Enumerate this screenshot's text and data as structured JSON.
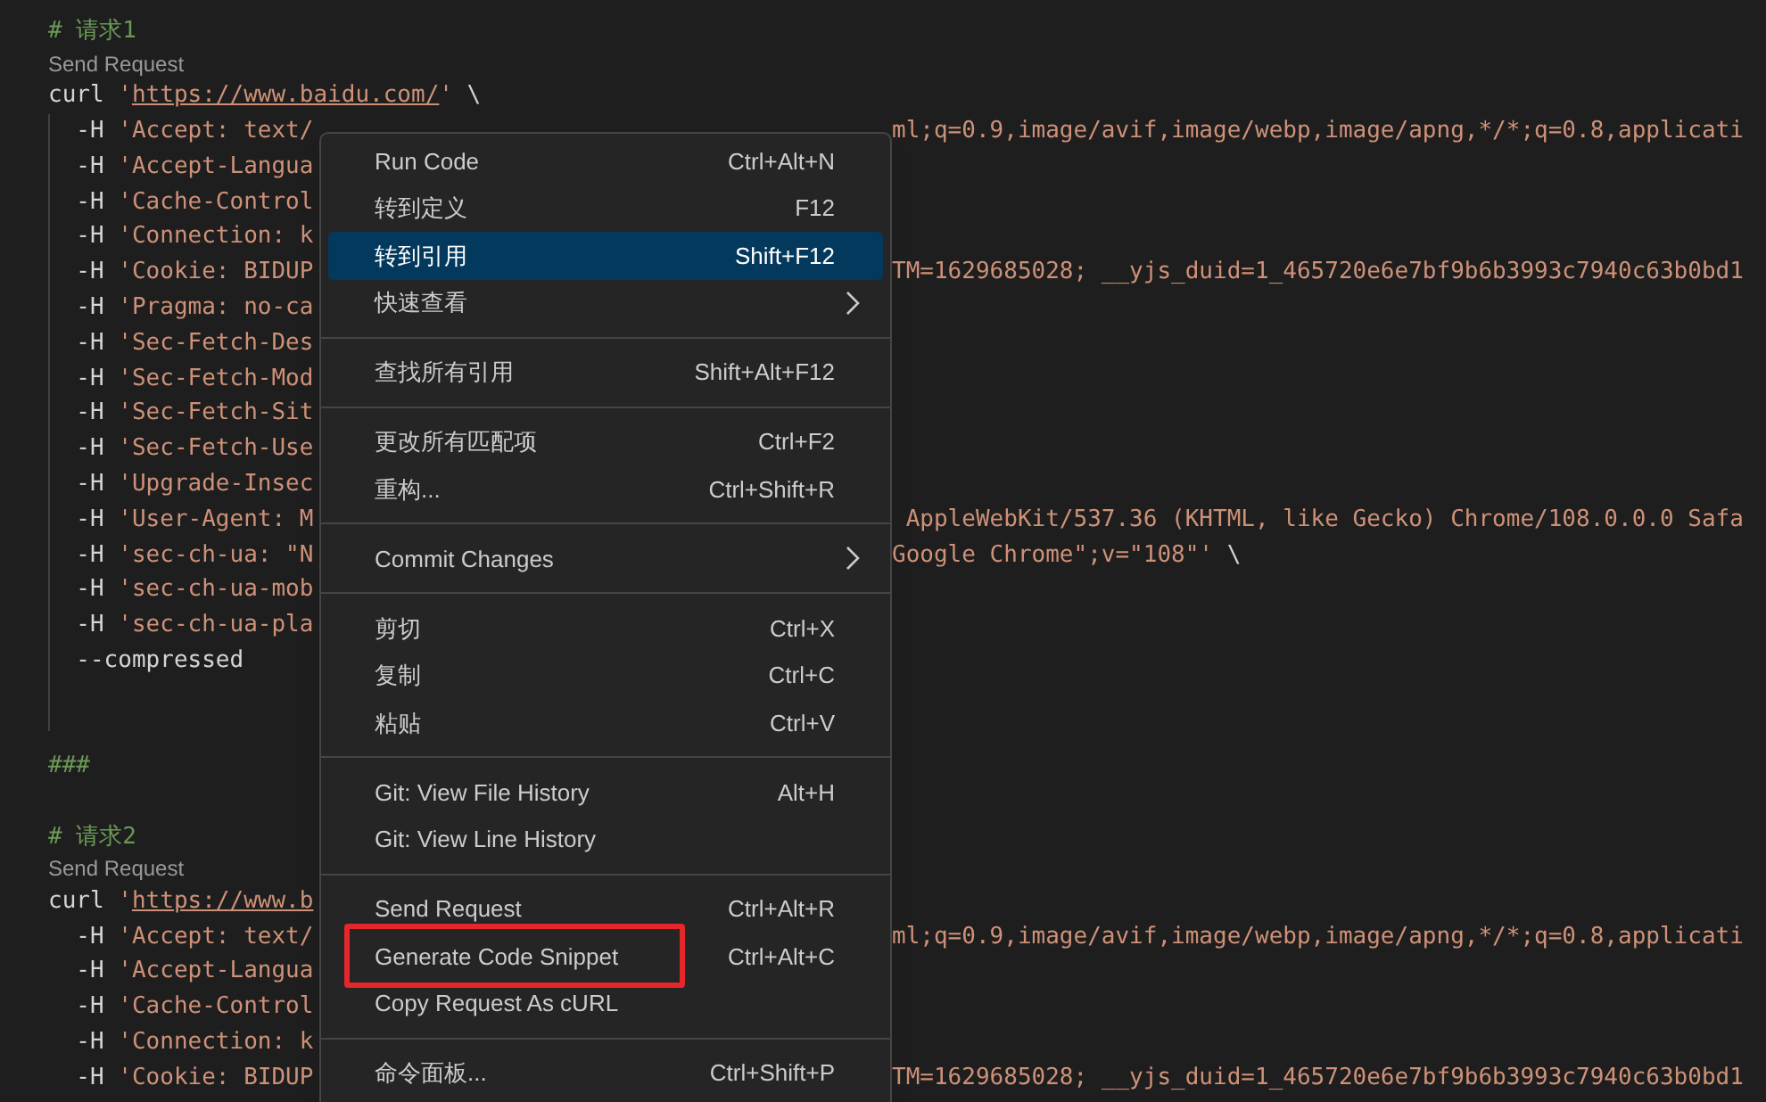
{
  "editor": {
    "lines": [
      {
        "kind": "code",
        "left": [
          {
            "text": "# 请求1",
            "kind": "comment"
          }
        ]
      },
      {
        "kind": "codelens",
        "left": [
          {
            "text": "Send Request",
            "kind": "lens"
          }
        ]
      },
      {
        "kind": "code",
        "left": [
          {
            "text": "curl ",
            "kind": "plain"
          },
          {
            "text": "'",
            "kind": "string"
          },
          {
            "text": "https://www.baidu.com/",
            "kind": "link"
          },
          {
            "text": "'",
            "kind": "string"
          },
          {
            "text": " \\",
            "kind": "plain"
          }
        ]
      },
      {
        "kind": "code",
        "left": [
          {
            "text": "  -H",
            "kind": "plain"
          },
          {
            "text": " 'Accept: text/",
            "kind": "string"
          }
        ],
        "right": [
          {
            "text": "ml;q=0.9,image/avif,image/webp,image/apng,*/*;q=0.8,applicati",
            "kind": "string"
          }
        ]
      },
      {
        "kind": "code",
        "left": [
          {
            "text": "  -H",
            "kind": "plain"
          },
          {
            "text": " 'Accept-Langua",
            "kind": "string"
          }
        ]
      },
      {
        "kind": "code",
        "left": [
          {
            "text": "  -H",
            "kind": "plain"
          },
          {
            "text": " 'Cache-Control",
            "kind": "string"
          }
        ]
      },
      {
        "kind": "code",
        "left": [
          {
            "text": "  -H",
            "kind": "plain"
          },
          {
            "text": " 'Connection: k",
            "kind": "string"
          }
        ]
      },
      {
        "kind": "code",
        "left": [
          {
            "text": "  -H",
            "kind": "plain"
          },
          {
            "text": " 'Cookie: BIDUP",
            "kind": "string"
          }
        ],
        "right": [
          {
            "text": "TM=1629685028; __yjs_duid=1_465720e6e7bf9b6b3993c7940c63b0bd1",
            "kind": "string"
          }
        ]
      },
      {
        "kind": "code",
        "left": [
          {
            "text": "  -H",
            "kind": "plain"
          },
          {
            "text": " 'Pragma: no-ca",
            "kind": "string"
          }
        ]
      },
      {
        "kind": "code",
        "left": [
          {
            "text": "  -H",
            "kind": "plain"
          },
          {
            "text": " 'Sec-Fetch-Des",
            "kind": "string"
          }
        ]
      },
      {
        "kind": "code",
        "left": [
          {
            "text": "  -H",
            "kind": "plain"
          },
          {
            "text": " 'Sec-Fetch-Mod",
            "kind": "string"
          }
        ]
      },
      {
        "kind": "code",
        "left": [
          {
            "text": "  -H",
            "kind": "plain"
          },
          {
            "text": " 'Sec-Fetch-Sit",
            "kind": "string"
          }
        ]
      },
      {
        "kind": "code",
        "left": [
          {
            "text": "  -H",
            "kind": "plain"
          },
          {
            "text": " 'Sec-Fetch-Use",
            "kind": "string"
          }
        ]
      },
      {
        "kind": "code",
        "left": [
          {
            "text": "  -H",
            "kind": "plain"
          },
          {
            "text": " 'Upgrade-Insec",
            "kind": "string"
          }
        ]
      },
      {
        "kind": "code",
        "left": [
          {
            "text": "  -H",
            "kind": "plain"
          },
          {
            "text": " 'User-Agent: M",
            "kind": "string"
          }
        ],
        "right": [
          {
            "text": " AppleWebKit/537.36 (KHTML, like Gecko) Chrome/108.0.0.0 Safa",
            "kind": "string"
          }
        ]
      },
      {
        "kind": "code",
        "left": [
          {
            "text": "  -H",
            "kind": "plain"
          },
          {
            "text": " 'sec-ch-ua: \"N",
            "kind": "string"
          }
        ],
        "right": [
          {
            "text": "Google Chrome\";v=\"108\"'",
            "kind": "string"
          },
          {
            "text": " \\",
            "kind": "plain"
          }
        ]
      },
      {
        "kind": "code",
        "left": [
          {
            "text": "  -H",
            "kind": "plain"
          },
          {
            "text": " 'sec-ch-ua-mob",
            "kind": "string"
          }
        ]
      },
      {
        "kind": "code",
        "left": [
          {
            "text": "  -H",
            "kind": "plain"
          },
          {
            "text": " 'sec-ch-ua-pla",
            "kind": "string"
          }
        ]
      },
      {
        "kind": "code",
        "left": [
          {
            "text": "  --compressed",
            "kind": "plain"
          }
        ]
      },
      {
        "kind": "blank"
      },
      {
        "kind": "blank"
      },
      {
        "kind": "code",
        "left": [
          {
            "text": "###",
            "kind": "comment"
          }
        ]
      },
      {
        "kind": "blank"
      },
      {
        "kind": "code",
        "left": [
          {
            "text": "# 请求2",
            "kind": "comment"
          }
        ]
      },
      {
        "kind": "codelens",
        "left": [
          {
            "text": "Send Request",
            "kind": "lens"
          }
        ]
      },
      {
        "kind": "code",
        "left": [
          {
            "text": "curl ",
            "kind": "plain"
          },
          {
            "text": "'",
            "kind": "string"
          },
          {
            "text": "https://www.b",
            "kind": "link"
          }
        ]
      },
      {
        "kind": "code",
        "left": [
          {
            "text": "  -H",
            "kind": "plain"
          },
          {
            "text": " 'Accept: text/",
            "kind": "string"
          }
        ],
        "right": [
          {
            "text": "ml;q=0.9,image/avif,image/webp,image/apng,*/*;q=0.8,applicati",
            "kind": "string"
          }
        ]
      },
      {
        "kind": "code",
        "left": [
          {
            "text": "  -H",
            "kind": "plain"
          },
          {
            "text": " 'Accept-Langua",
            "kind": "string"
          }
        ]
      },
      {
        "kind": "code",
        "left": [
          {
            "text": "  -H",
            "kind": "plain"
          },
          {
            "text": " 'Cache-Control",
            "kind": "string"
          }
        ]
      },
      {
        "kind": "code",
        "left": [
          {
            "text": "  -H",
            "kind": "plain"
          },
          {
            "text": " 'Connection: k",
            "kind": "string"
          }
        ]
      },
      {
        "kind": "code",
        "left": [
          {
            "text": "  -H",
            "kind": "plain"
          },
          {
            "text": " 'Cookie: BIDUP",
            "kind": "string"
          }
        ],
        "right": [
          {
            "text": "TM=1629685028; __yjs_duid=1_465720e6e7bf9b6b3993c7940c63b0bd1",
            "kind": "string"
          }
        ]
      }
    ]
  },
  "context_menu": {
    "items": [
      {
        "kind": "item",
        "label": "Run Code",
        "shortcut": "Ctrl+Alt+N",
        "selected": false
      },
      {
        "kind": "item",
        "label": "转到定义",
        "shortcut": "F12",
        "selected": false
      },
      {
        "kind": "item",
        "label": "转到引用",
        "shortcut": "Shift+F12",
        "selected": true
      },
      {
        "kind": "item",
        "label": "快速查看",
        "submenu": true,
        "selected": false
      },
      {
        "kind": "separator"
      },
      {
        "kind": "item",
        "label": "查找所有引用",
        "shortcut": "Shift+Alt+F12",
        "selected": false
      },
      {
        "kind": "separator"
      },
      {
        "kind": "item",
        "label": "更改所有匹配项",
        "shortcut": "Ctrl+F2",
        "selected": false
      },
      {
        "kind": "item",
        "label": "重构...",
        "shortcut": "Ctrl+Shift+R",
        "selected": false
      },
      {
        "kind": "separator"
      },
      {
        "kind": "item",
        "label": "Commit Changes",
        "submenu": true,
        "selected": false
      },
      {
        "kind": "separator"
      },
      {
        "kind": "item",
        "label": "剪切",
        "shortcut": "Ctrl+X",
        "selected": false
      },
      {
        "kind": "item",
        "label": "复制",
        "shortcut": "Ctrl+C",
        "selected": false
      },
      {
        "kind": "item",
        "label": "粘贴",
        "shortcut": "Ctrl+V",
        "selected": false
      },
      {
        "kind": "separator"
      },
      {
        "kind": "item",
        "label": "Git: View File History",
        "shortcut": "Alt+H",
        "selected": false
      },
      {
        "kind": "item",
        "label": "Git: View Line History",
        "selected": false
      },
      {
        "kind": "separator"
      },
      {
        "kind": "item",
        "label": "Send Request",
        "shortcut": "Ctrl+Alt+R",
        "selected": false
      },
      {
        "kind": "item",
        "label": "Generate Code Snippet",
        "shortcut": "Ctrl+Alt+C",
        "selected": false,
        "highlighted": true
      },
      {
        "kind": "item",
        "label": "Copy Request As cURL",
        "selected": false
      },
      {
        "kind": "separator"
      },
      {
        "kind": "item",
        "label": "命令面板...",
        "shortcut": "Ctrl+Shift+P",
        "selected": false
      }
    ]
  }
}
